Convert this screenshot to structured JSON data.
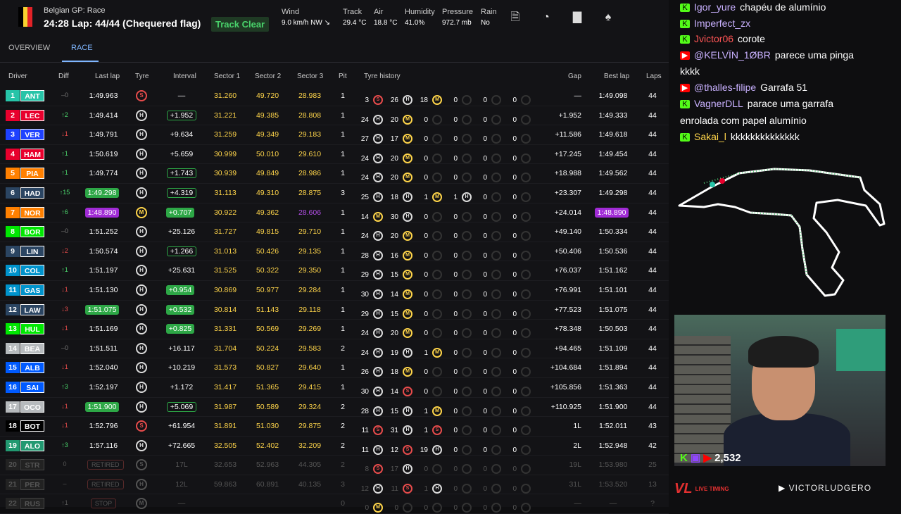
{
  "header": {
    "race_name": "Belgian GP: Race",
    "status_line": "24:28 Lap: 44/44 (Chequered flag)",
    "track_status": "Track Clear",
    "flag_colors": [
      "#000000",
      "#f6d130",
      "#e32227"
    ],
    "weather": [
      {
        "label": "Wind",
        "value": "9.0 km/h NW ↘"
      },
      {
        "label": "Track",
        "value": "29.4 °C"
      },
      {
        "label": "Air",
        "value": "18.8 °C"
      },
      {
        "label": "Humidity",
        "value": "41.0%"
      },
      {
        "label": "Pressure",
        "value": "972.7 mb"
      },
      {
        "label": "Rain",
        "value": "No"
      }
    ],
    "icons": [
      "document-icon",
      "speedometer-icon",
      "chart-icon",
      "trophy-icon"
    ]
  },
  "tabs": [
    {
      "label": "OVERVIEW",
      "active": false
    },
    {
      "label": "RACE",
      "active": true
    }
  ],
  "columns": [
    "Driver",
    "Diff",
    "Last lap",
    "Tyre",
    "Interval",
    "Sector 1",
    "Sector 2",
    "Sector 3",
    "Pit",
    "Tyre history",
    "Gap",
    "Best lap",
    "Laps"
  ],
  "rows": [
    {
      "pos": "1",
      "code": "ANT",
      "color": "#27c4a8",
      "diff": "–0",
      "last": "1:49.963",
      "tyre": "S",
      "tyre_color": "#e84c4c",
      "interval": "—",
      "s1": "31.260",
      "s2": "49.720",
      "s3": "28.983",
      "pit": "1",
      "hist": [
        [
          "3",
          "S"
        ],
        [
          "26",
          "H"
        ],
        [
          "18",
          "M"
        ],
        [
          "0",
          ""
        ],
        [
          "0",
          ""
        ],
        [
          "0",
          ""
        ]
      ],
      "gap": "—",
      "best": "1:49.098",
      "laps": "44"
    },
    {
      "pos": "2",
      "code": "LEC",
      "color": "#e8002d",
      "diff": "↑2",
      "last": "1:49.414",
      "tyre": "H",
      "tyre_color": "#dddddd",
      "interval": "+1.952",
      "interval_style": "gbox",
      "s1": "31.221",
      "s2": "49.385",
      "s3": "28.808",
      "pit": "1",
      "hist": [
        [
          "24",
          "H"
        ],
        [
          "20",
          "M"
        ],
        [
          "0",
          ""
        ],
        [
          "0",
          ""
        ],
        [
          "0",
          ""
        ],
        [
          "0",
          ""
        ]
      ],
      "gap": "+1.952",
      "best": "1:49.333",
      "laps": "44"
    },
    {
      "pos": "3",
      "code": "VER",
      "color": "#1e41ff",
      "diff": "↓1",
      "last": "1:49.791",
      "tyre": "H",
      "tyre_color": "#dddddd",
      "interval": "+9.634",
      "s1": "31.259",
      "s2": "49.349",
      "s3": "29.183",
      "pit": "1",
      "hist": [
        [
          "27",
          "H"
        ],
        [
          "17",
          "M"
        ],
        [
          "0",
          ""
        ],
        [
          "0",
          ""
        ],
        [
          "0",
          ""
        ],
        [
          "0",
          ""
        ]
      ],
      "gap": "+11.586",
      "best": "1:49.618",
      "laps": "44"
    },
    {
      "pos": "4",
      "code": "HAM",
      "color": "#e8002d",
      "diff": "↑1",
      "last": "1:50.619",
      "tyre": "H",
      "tyre_color": "#dddddd",
      "interval": "+5.659",
      "s1": "30.999",
      "s2": "50.010",
      "s3": "29.610",
      "pit": "1",
      "hist": [
        [
          "24",
          "H"
        ],
        [
          "20",
          "M"
        ],
        [
          "0",
          ""
        ],
        [
          "0",
          ""
        ],
        [
          "0",
          ""
        ],
        [
          "0",
          ""
        ]
      ],
      "gap": "+17.245",
      "best": "1:49.454",
      "laps": "44"
    },
    {
      "pos": "5",
      "code": "PIA",
      "color": "#ff8000",
      "diff": "↑1",
      "last": "1:49.774",
      "tyre": "H",
      "tyre_color": "#dddddd",
      "interval": "+1.743",
      "interval_style": "gbox",
      "s1": "30.939",
      "s2": "49.849",
      "s3": "28.986",
      "pit": "1",
      "hist": [
        [
          "24",
          "H"
        ],
        [
          "20",
          "M"
        ],
        [
          "0",
          ""
        ],
        [
          "0",
          ""
        ],
        [
          "0",
          ""
        ],
        [
          "0",
          ""
        ]
      ],
      "gap": "+18.988",
      "best": "1:49.562",
      "laps": "44"
    },
    {
      "pos": "6",
      "code": "HAD",
      "color": "#2b4562",
      "diff": "↑15",
      "last": "1:49.298",
      "last_style": "g",
      "tyre": "H",
      "tyre_color": "#dddddd",
      "interval": "+4.319",
      "interval_style": "gbox",
      "s1": "31.113",
      "s2": "49.310",
      "s3": "28.875",
      "pit": "3",
      "hist": [
        [
          "25",
          "H"
        ],
        [
          "18",
          "H"
        ],
        [
          "1",
          "M"
        ],
        [
          "1",
          "H"
        ],
        [
          "0",
          ""
        ],
        [
          "0",
          ""
        ]
      ],
      "gap": "+23.307",
      "best": "1:49.298",
      "laps": "44"
    },
    {
      "pos": "7",
      "code": "NOR",
      "color": "#ff8000",
      "diff": "↑6",
      "last": "1:48.890",
      "last_style": "p",
      "tyre": "M",
      "tyre_color": "#ffd54a",
      "interval": "+0.707",
      "interval_style": "g",
      "s1": "30.922",
      "s2": "49.362",
      "s3": "28.606",
      "s3_purple": true,
      "pit": "1",
      "hist": [
        [
          "14",
          "M"
        ],
        [
          "30",
          "H"
        ],
        [
          "0",
          ""
        ],
        [
          "0",
          ""
        ],
        [
          "0",
          ""
        ],
        [
          "0",
          ""
        ]
      ],
      "gap": "+24.014",
      "best": "1:48.890",
      "best_style": "p",
      "laps": "44"
    },
    {
      "pos": "8",
      "code": "BOR",
      "color": "#00e701",
      "diff": "–0",
      "last": "1:51.252",
      "tyre": "H",
      "tyre_color": "#dddddd",
      "interval": "+25.126",
      "s1": "31.727",
      "s2": "49.815",
      "s3": "29.710",
      "pit": "1",
      "hist": [
        [
          "24",
          "H"
        ],
        [
          "20",
          "M"
        ],
        [
          "0",
          ""
        ],
        [
          "0",
          ""
        ],
        [
          "0",
          ""
        ],
        [
          "0",
          ""
        ]
      ],
      "gap": "+49.140",
      "best": "1:50.334",
      "laps": "44"
    },
    {
      "pos": "9",
      "code": "LIN",
      "color": "#2b4562",
      "diff": "↓2",
      "last": "1:50.574",
      "tyre": "H",
      "tyre_color": "#dddddd",
      "interval": "+1.266",
      "interval_style": "gbox",
      "s1": "31.013",
      "s2": "50.426",
      "s3": "29.135",
      "pit": "1",
      "hist": [
        [
          "28",
          "H"
        ],
        [
          "16",
          "M"
        ],
        [
          "0",
          ""
        ],
        [
          "0",
          ""
        ],
        [
          "0",
          ""
        ],
        [
          "0",
          ""
        ]
      ],
      "gap": "+50.406",
      "best": "1:50.536",
      "laps": "44"
    },
    {
      "pos": "10",
      "code": "COL",
      "color": "#0093cc",
      "diff": "↑1",
      "last": "1:51.197",
      "tyre": "H",
      "tyre_color": "#dddddd",
      "interval": "+25.631",
      "s1": "31.525",
      "s2": "50.322",
      "s3": "29.350",
      "pit": "1",
      "hist": [
        [
          "29",
          "H"
        ],
        [
          "15",
          "M"
        ],
        [
          "0",
          ""
        ],
        [
          "0",
          ""
        ],
        [
          "0",
          ""
        ],
        [
          "0",
          ""
        ]
      ],
      "gap": "+76.037",
      "best": "1:51.162",
      "laps": "44"
    },
    {
      "pos": "11",
      "code": "GAS",
      "color": "#0093cc",
      "diff": "↓1",
      "last": "1:51.130",
      "tyre": "H",
      "tyre_color": "#dddddd",
      "interval": "+0.954",
      "interval_style": "g",
      "s1": "30.869",
      "s2": "50.977",
      "s3": "29.284",
      "pit": "1",
      "hist": [
        [
          "30",
          "H"
        ],
        [
          "14",
          "M"
        ],
        [
          "0",
          ""
        ],
        [
          "0",
          ""
        ],
        [
          "0",
          ""
        ],
        [
          "0",
          ""
        ]
      ],
      "gap": "+76.991",
      "best": "1:51.101",
      "laps": "44"
    },
    {
      "pos": "12",
      "code": "LAW",
      "color": "#2b4562",
      "diff": "↓3",
      "last": "1:51.075",
      "last_style": "g",
      "tyre": "H",
      "tyre_color": "#dddddd",
      "interval": "+0.532",
      "interval_style": "g",
      "s1": "30.814",
      "s2": "51.143",
      "s3": "29.118",
      "pit": "1",
      "hist": [
        [
          "29",
          "H"
        ],
        [
          "15",
          "M"
        ],
        [
          "0",
          ""
        ],
        [
          "0",
          ""
        ],
        [
          "0",
          ""
        ],
        [
          "0",
          ""
        ]
      ],
      "gap": "+77.523",
      "best": "1:51.075",
      "laps": "44"
    },
    {
      "pos": "13",
      "code": "HUL",
      "color": "#00e701",
      "diff": "↓1",
      "last": "1:51.169",
      "tyre": "H",
      "tyre_color": "#dddddd",
      "interval": "+0.825",
      "interval_style": "g",
      "s1": "31.331",
      "s2": "50.569",
      "s3": "29.269",
      "pit": "1",
      "hist": [
        [
          "24",
          "H"
        ],
        [
          "20",
          "M"
        ],
        [
          "0",
          ""
        ],
        [
          "0",
          ""
        ],
        [
          "0",
          ""
        ],
        [
          "0",
          ""
        ]
      ],
      "gap": "+78.348",
      "best": "1:50.503",
      "laps": "44"
    },
    {
      "pos": "14",
      "code": "BEA",
      "color": "#b6babd",
      "diff": "–0",
      "last": "1:51.511",
      "tyre": "H",
      "tyre_color": "#dddddd",
      "interval": "+16.117",
      "s1": "31.704",
      "s2": "50.224",
      "s3": "29.583",
      "pit": "2",
      "hist": [
        [
          "24",
          "H"
        ],
        [
          "19",
          "H"
        ],
        [
          "1",
          "M"
        ],
        [
          "0",
          ""
        ],
        [
          "0",
          ""
        ],
        [
          "0",
          ""
        ]
      ],
      "gap": "+94.465",
      "best": "1:51.109",
      "laps": "44"
    },
    {
      "pos": "15",
      "code": "ALB",
      "color": "#005aff",
      "diff": "↓1",
      "last": "1:52.040",
      "tyre": "H",
      "tyre_color": "#dddddd",
      "interval": "+10.219",
      "s1": "31.573",
      "s2": "50.827",
      "s3": "29.640",
      "pit": "1",
      "hist": [
        [
          "26",
          "H"
        ],
        [
          "18",
          "M"
        ],
        [
          "0",
          ""
        ],
        [
          "0",
          ""
        ],
        [
          "0",
          ""
        ],
        [
          "0",
          ""
        ]
      ],
      "gap": "+104.684",
      "best": "1:51.894",
      "laps": "44"
    },
    {
      "pos": "16",
      "code": "SAI",
      "color": "#005aff",
      "diff": "↑3",
      "last": "1:52.197",
      "tyre": "H",
      "tyre_color": "#dddddd",
      "interval": "+1.172",
      "s1": "31.417",
      "s2": "51.365",
      "s3": "29.415",
      "pit": "1",
      "hist": [
        [
          "30",
          "H"
        ],
        [
          "14",
          "S"
        ],
        [
          "0",
          ""
        ],
        [
          "0",
          ""
        ],
        [
          "0",
          ""
        ],
        [
          "0",
          ""
        ]
      ],
      "gap": "+105.856",
      "best": "1:51.363",
      "laps": "44"
    },
    {
      "pos": "17",
      "code": "OCO",
      "color": "#b6babd",
      "diff": "↓1",
      "last": "1:51.900",
      "last_style": "g",
      "tyre": "H",
      "tyre_color": "#dddddd",
      "interval": "+5.069",
      "interval_style": "gbox",
      "s1": "31.987",
      "s2": "50.589",
      "s3": "29.324",
      "pit": "2",
      "hist": [
        [
          "28",
          "H"
        ],
        [
          "15",
          "H"
        ],
        [
          "1",
          "M"
        ],
        [
          "0",
          ""
        ],
        [
          "0",
          ""
        ],
        [
          "0",
          ""
        ]
      ],
      "gap": "+110.925",
      "best": "1:51.900",
      "laps": "44"
    },
    {
      "pos": "18",
      "code": "BOT",
      "color": "#000000",
      "diff": "↓1",
      "last": "1:52.796",
      "tyre": "S",
      "tyre_color": "#e84c4c",
      "interval": "+61.954",
      "s1": "31.891",
      "s2": "51.030",
      "s3": "29.875",
      "pit": "2",
      "hist": [
        [
          "11",
          "S"
        ],
        [
          "31",
          "H"
        ],
        [
          "1",
          "S"
        ],
        [
          "0",
          ""
        ],
        [
          "0",
          ""
        ],
        [
          "0",
          ""
        ]
      ],
      "gap": "1L",
      "best": "1:52.011",
      "laps": "43"
    },
    {
      "pos": "19",
      "code": "ALO",
      "color": "#229971",
      "diff": "↑3",
      "last": "1:57.116",
      "tyre": "H",
      "tyre_color": "#dddddd",
      "interval": "+72.665",
      "s1": "32.505",
      "s2": "52.402",
      "s3": "32.209",
      "pit": "2",
      "hist": [
        [
          "11",
          "H"
        ],
        [
          "12",
          "S"
        ],
        [
          "19",
          "H"
        ],
        [
          "0",
          ""
        ],
        [
          "0",
          ""
        ],
        [
          "0",
          ""
        ]
      ],
      "gap": "2L",
      "best": "1:52.948",
      "laps": "42"
    },
    {
      "pos": "20",
      "code": "STR",
      "color": "#229971",
      "retired": true,
      "diff": "0",
      "last": "RETIRED",
      "tyre": "S",
      "tyre_color": "#555555",
      "interval": "17L",
      "s1": "32.653",
      "s2": "52.963",
      "s3": "44.305",
      "pit": "2",
      "hist": [
        [
          "8",
          "S"
        ],
        [
          "17",
          "H"
        ],
        [
          "0",
          ""
        ],
        [
          "0",
          ""
        ],
        [
          "0",
          ""
        ],
        [
          "0",
          ""
        ]
      ],
      "gap": "19L",
      "best": "1:53.980",
      "laps": "25"
    },
    {
      "pos": "21",
      "code": "PER",
      "color": "#1e41ff",
      "retired": true,
      "diff": "–",
      "last": "RETIRED",
      "tyre": "H",
      "tyre_color": "#555555",
      "interval": "12L",
      "s1": "59.863",
      "s2": "60.891",
      "s3": "40.135",
      "pit": "3",
      "hist": [
        [
          "12",
          "H"
        ],
        [
          "11",
          "S"
        ],
        [
          "1",
          "H"
        ],
        [
          "0",
          ""
        ],
        [
          "0",
          ""
        ],
        [
          "0",
          ""
        ]
      ],
      "gap": "31L",
      "best": "1:53.520",
      "laps": "13"
    },
    {
      "pos": "22",
      "code": "RUS",
      "color": "#27c4a8",
      "retired": true,
      "diff": "↑1",
      "last": "STOP",
      "tyre": "M",
      "tyre_color": "#555555",
      "interval": "—",
      "s1": "",
      "s2": "",
      "s3": "",
      "pit": "0",
      "hist": [
        [
          "0",
          "M"
        ],
        [
          "0",
          ""
        ],
        [
          "0",
          ""
        ],
        [
          "0",
          ""
        ],
        [
          "0",
          ""
        ],
        [
          "0",
          ""
        ]
      ],
      "gap": "—",
      "best": "—",
      "laps": "?"
    }
  ],
  "chat": [
    {
      "user": "Igor_yure",
      "user_color": "#c9b1ff",
      "badge": "K",
      "badge_color": "#53fc18",
      "msg": "chapéu de alumínio"
    },
    {
      "user": "Imperfect_zx",
      "user_color": "#c9b1ff",
      "badge": "K",
      "badge_color": "#53fc18",
      "msg": ""
    },
    {
      "user": "Jvictor06",
      "user_color": "#ff5555",
      "badge": "K",
      "badge_color": "#53fc18",
      "msg": "corote"
    },
    {
      "user": "@KELVÏN_1ØBR",
      "user_color": "#c9b1ff",
      "badge": "▶",
      "badge_color": "#ff0000",
      "msg": "parece uma pinga"
    },
    {
      "user": "",
      "user_color": "#fff",
      "badge": "",
      "badge_color": "",
      "msg": "kkkk"
    },
    {
      "user": "@thalles-filipe",
      "user_color": "#c9b1ff",
      "badge": "▶",
      "badge_color": "#ff0000",
      "msg": "Garrafa 51"
    },
    {
      "user": "VagnerDLL",
      "user_color": "#c9b1ff",
      "badge": "K",
      "badge_color": "#53fc18",
      "msg": "parace uma garrafa"
    },
    {
      "user": "",
      "user_color": "#fff",
      "badge": "",
      "badge_color": "",
      "msg": "enrolada com papel alumínio"
    },
    {
      "user": "Sakai_l",
      "user_color": "#ffd54a",
      "badge": "K",
      "badge_color": "#53fc18",
      "msg": "kkkkkkkkkkkkkk"
    }
  ],
  "viewers": "2,532",
  "brand": {
    "logo": "VL",
    "logo_sub": "LIVE TIMING",
    "channel": "VICTORLUDGERO"
  }
}
